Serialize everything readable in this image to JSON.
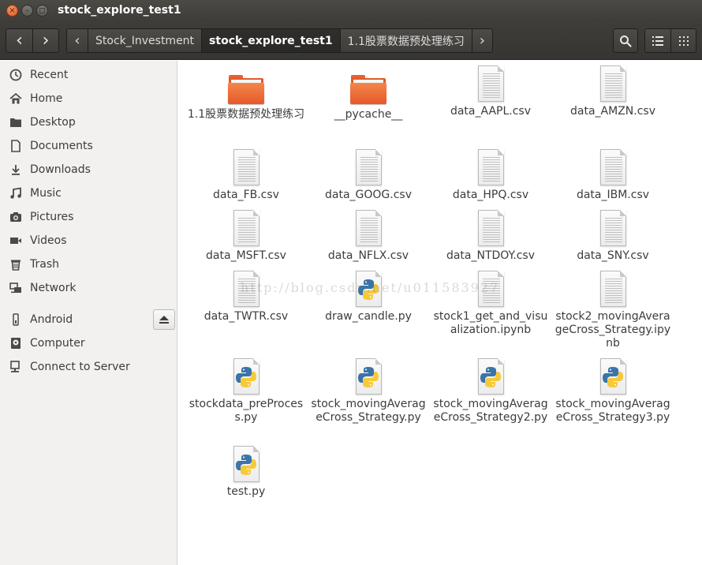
{
  "window": {
    "title": "stock_explore_test1",
    "close_glyph": "×",
    "min_glyph": "–",
    "max_glyph": "◻"
  },
  "toolbar": {
    "back_glyph": "‹",
    "forward_glyph": "›",
    "crumb_left_glyph": "‹",
    "crumb_right_glyph": "›",
    "breadcrumbs": [
      "Stock_Investment",
      "stock_explore_test1",
      "1.1股票数据预处理练习"
    ]
  },
  "sidebar": {
    "items": [
      {
        "label": "Recent",
        "icon": "clock-icon"
      },
      {
        "label": "Home",
        "icon": "home-icon"
      },
      {
        "label": "Desktop",
        "icon": "folder-icon"
      },
      {
        "label": "Documents",
        "icon": "document-icon"
      },
      {
        "label": "Downloads",
        "icon": "download-icon"
      },
      {
        "label": "Music",
        "icon": "music-icon"
      },
      {
        "label": "Pictures",
        "icon": "camera-icon"
      },
      {
        "label": "Videos",
        "icon": "video-icon"
      },
      {
        "label": "Trash",
        "icon": "trash-icon"
      },
      {
        "label": "Network",
        "icon": "network-icon"
      },
      {
        "label": "Android",
        "icon": "device-icon"
      },
      {
        "label": "Computer",
        "icon": "computer-icon"
      },
      {
        "label": "Connect to Server",
        "icon": "server-icon"
      }
    ]
  },
  "files": [
    {
      "name": "1.1股票数据预处理练习",
      "type": "folder"
    },
    {
      "name": "__pycache__",
      "type": "folder"
    },
    {
      "name": "data_AAPL.csv",
      "type": "csv"
    },
    {
      "name": "data_AMZN.csv",
      "type": "csv"
    },
    {
      "name": "data_FB.csv",
      "type": "csv"
    },
    {
      "name": "data_GOOG.csv",
      "type": "csv"
    },
    {
      "name": "data_HPQ.csv",
      "type": "csv"
    },
    {
      "name": "data_IBM.csv",
      "type": "csv"
    },
    {
      "name": "data_MSFT.csv",
      "type": "csv"
    },
    {
      "name": "data_NFLX.csv",
      "type": "csv"
    },
    {
      "name": "data_NTDOY.csv",
      "type": "csv"
    },
    {
      "name": "data_SNY.csv",
      "type": "csv"
    },
    {
      "name": "data_TWTR.csv",
      "type": "csv"
    },
    {
      "name": "draw_candle.py",
      "type": "py"
    },
    {
      "name": "stock1_get_and_visualization.ipynb",
      "type": "ipynb"
    },
    {
      "name": "stock2_movingAverageCross_Strategy.ipynb",
      "type": "ipynb"
    },
    {
      "name": "stockdata_preProcess.py",
      "type": "py"
    },
    {
      "name": "stock_movingAverageCross_Strategy.py",
      "type": "py"
    },
    {
      "name": "stock_movingAverageCross_Strategy2.py",
      "type": "py"
    },
    {
      "name": "stock_movingAverageCross_Strategy3.py",
      "type": "py"
    },
    {
      "name": "test.py",
      "type": "py"
    }
  ],
  "watermark": "http://blog.csdn.net/u011583927",
  "colors": {
    "folder_orange": "#e5592a",
    "titlebar": "#3d3c38",
    "sidebar_bg": "#f2f1f0"
  }
}
